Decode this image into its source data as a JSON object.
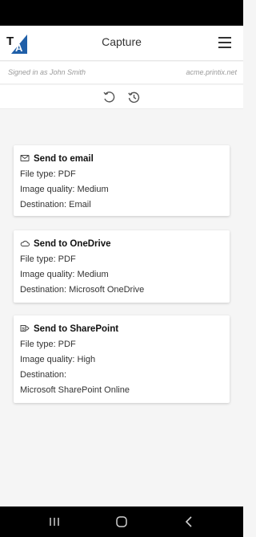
{
  "header": {
    "title": "Capture",
    "logo_text": "TA"
  },
  "session": {
    "signed_in": "Signed in as John Smith",
    "domain": "acme.printix.net"
  },
  "cards": [
    {
      "title": "Send to email",
      "icon": "mail-icon",
      "lines": [
        "File type: PDF",
        "Image quality: Medium",
        "Destination: Email"
      ]
    },
    {
      "title": "Send to OneDrive",
      "icon": "cloud-icon",
      "lines": [
        "File type: PDF",
        "Image quality: Medium",
        "Destination: Microsoft OneDrive"
      ]
    },
    {
      "title": "Send to SharePoint",
      "icon": "sharepoint-icon",
      "lines": [
        "File type: PDF",
        "Image quality: High",
        "Destination:",
        "Microsoft SharePoint Online"
      ]
    }
  ],
  "colors": {
    "logo_blue": "#1f5fa8",
    "background": "#f5f5f5",
    "card": "#ffffff"
  }
}
